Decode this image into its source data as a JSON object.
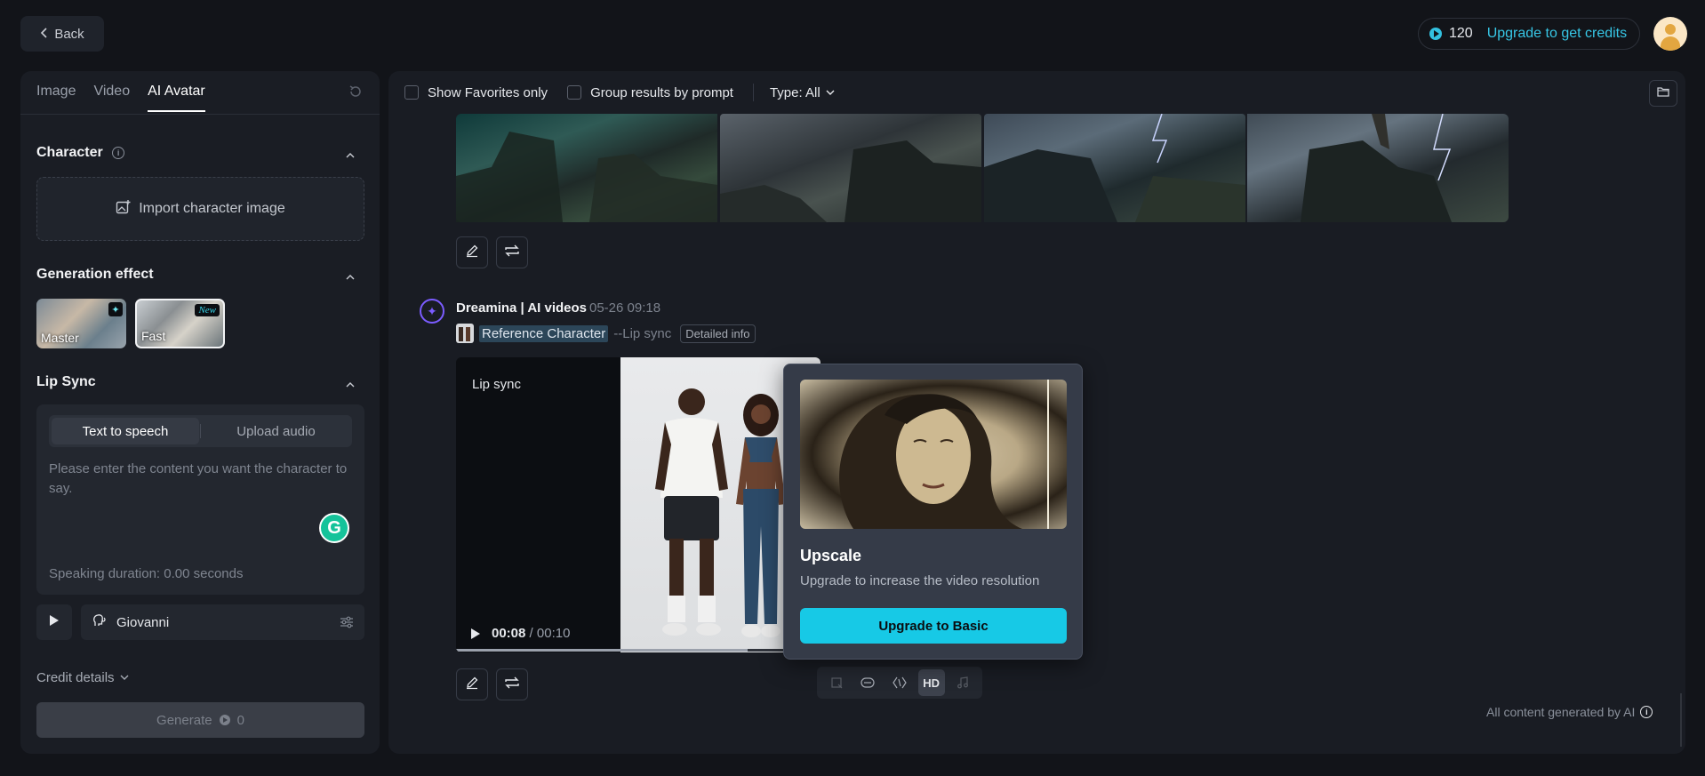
{
  "topbar": {
    "back_label": "Back",
    "credits_count": "120",
    "credits_upgrade": "Upgrade to get credits"
  },
  "sidebar": {
    "tabs": [
      {
        "label": "Image",
        "active": false
      },
      {
        "label": "Video",
        "active": false
      },
      {
        "label": "AI Avatar",
        "active": true
      }
    ],
    "character": {
      "title": "Character",
      "import_label": "Import character image"
    },
    "generation_effect": {
      "title": "Generation effect",
      "options": [
        {
          "label": "Master",
          "selected": false
        },
        {
          "label": "Fast",
          "badge": "New",
          "selected": true
        }
      ]
    },
    "lip_sync": {
      "title": "Lip Sync",
      "modes": [
        "Text to speech",
        "Upload audio"
      ],
      "active_mode": "Text to speech",
      "placeholder": "Please enter the content you want the character to say.",
      "duration": "Speaking duration: 0.00 seconds",
      "voice": "Giovanni"
    },
    "credit_details_label": "Credit details",
    "generate_label": "Generate",
    "generate_cost": "0"
  },
  "main": {
    "filters": {
      "favorites_label": "Show Favorites only",
      "group_label": "Group results by prompt",
      "type_label": "Type: All"
    },
    "result": {
      "source": "Dreamina | AI videos",
      "timestamp": "05-26  09:18",
      "reference_label": "Reference Character",
      "mode_suffix": "--Lip sync",
      "detail_label": "Detailed info",
      "video_label": "Lip sync",
      "time_current": "00:08",
      "time_total": "/ 00:10",
      "progress": 0.8
    },
    "upscale_popup": {
      "title": "Upscale",
      "description": "Upgrade to increase the video resolution",
      "button": "Upgrade to Basic"
    },
    "tool_hd_label": "HD",
    "footer_note": "All content generated by AI"
  },
  "colors": {
    "accent": "#17c9e6",
    "brand_purple": "#7b5cff",
    "background": "#121419",
    "panel": "#1a1d24"
  }
}
